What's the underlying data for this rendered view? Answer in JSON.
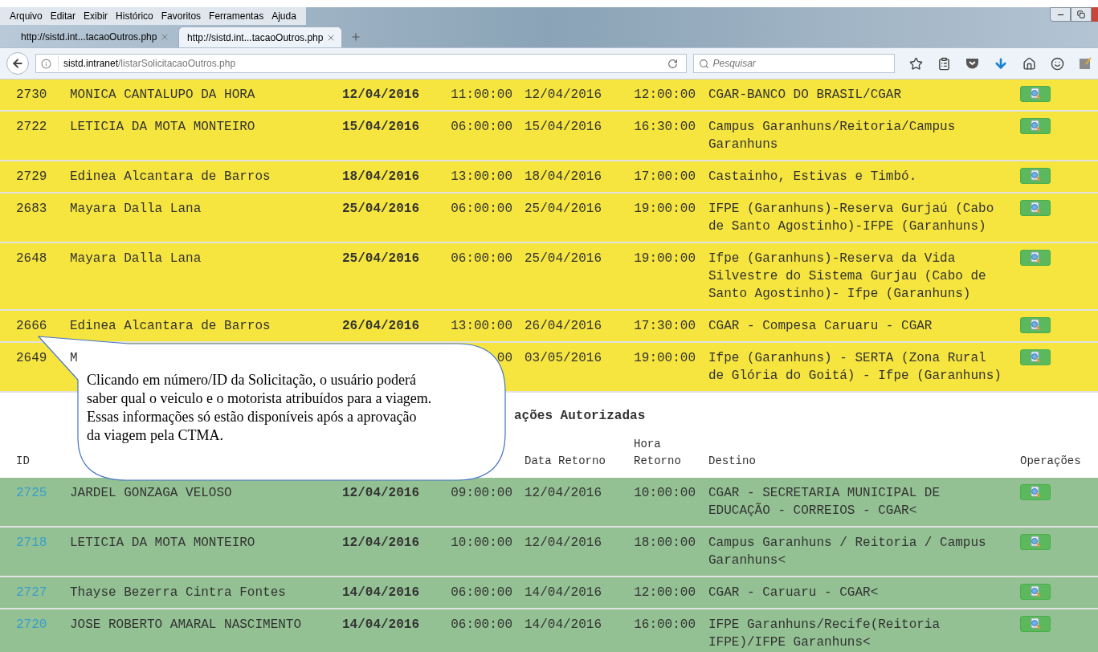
{
  "browser": {
    "menu": [
      "Arquivo",
      "Editar",
      "Exibir",
      "Histórico",
      "Favoritos",
      "Ferramentas",
      "Ajuda"
    ],
    "tabs": [
      {
        "title": "http://sistd.int...tacaoOutros.php",
        "selected": false
      },
      {
        "title": "http://sistd.int...tacaoOutros.php",
        "selected": true
      }
    ],
    "address": {
      "host": "sistd.intranet",
      "path": "/listarSolicitacaoOutros.php"
    },
    "search": {
      "placeholder": "Pesquisar"
    }
  },
  "tables": [
    {
      "kind": "pending",
      "rows": [
        {
          "id": "2730",
          "name": "MONICA CANTALUPO DA HORA",
          "depart_date": "12/04/2016",
          "depart_time": "11:00:00",
          "return_date": "12/04/2016",
          "return_time": "12:00:00",
          "destination": "CGAR-BANCO DO BRASIL/CGAR"
        },
        {
          "id": "2722",
          "name": "LETICIA DA MOTA MONTEIRO",
          "depart_date": "15/04/2016",
          "depart_time": "06:00:00",
          "return_date": "15/04/2016",
          "return_time": "16:30:00",
          "destination": "Campus Garanhuns/Reitoria/Campus Garanhuns"
        },
        {
          "id": "2729",
          "name": "Edinea Alcantara de Barros",
          "depart_date": "18/04/2016",
          "depart_time": "13:00:00",
          "return_date": "18/04/2016",
          "return_time": "17:00:00",
          "destination": "Castainho, Estivas e Timbó."
        },
        {
          "id": "2683",
          "name": "Mayara Dalla Lana",
          "depart_date": "25/04/2016",
          "depart_time": "06:00:00",
          "return_date": "25/04/2016",
          "return_time": "19:00:00",
          "destination": "IFPE (Garanhuns)-Reserva Gurjaú (Cabo de Santo Agostinho)-IFPE (Garanhuns)"
        },
        {
          "id": "2648",
          "name": "Mayara Dalla Lana",
          "depart_date": "25/04/2016",
          "depart_time": "06:00:00",
          "return_date": "25/04/2016",
          "return_time": "19:00:00",
          "destination": "Ifpe (Garanhuns)-Reserva da Vida Silvestre do Sistema Gurjau (Cabo de Santo Agostinho)- Ifpe (Garanhuns)"
        },
        {
          "id": "2666",
          "name": "Edinea Alcantara de Barros",
          "depart_date": "26/04/2016",
          "depart_time": "13:00:00",
          "return_date": "26/04/2016",
          "return_time": "17:30:00",
          "destination": "CGAR - Compesa Caruaru - CGAR"
        },
        {
          "id": "2649",
          "name": "M",
          "depart_time": "00",
          "return_date": "03/05/2016",
          "return_time": "19:00:00",
          "destination": "Ifpe (Garanhuns) - SERTA (Zona Rural de Glória do Goitá) - Ifpe (Garanhuns)"
        }
      ]
    },
    {
      "kind": "authorized",
      "title": "ações Autorizadas",
      "columns": {
        "id": "ID",
        "return_date": "Data Retorno",
        "return_time": "Hora Retorno",
        "destination": "Destino",
        "operations": "Operações"
      },
      "rows": [
        {
          "id": "2725",
          "name": "JARDEL GONZAGA VELOSO",
          "depart_date": "12/04/2016",
          "depart_time": "09:00:00",
          "return_date": "12/04/2016",
          "return_time": "10:00:00",
          "destination": "CGAR - SECRETARIA MUNICIPAL DE EDUCAÇÃO - CORREIOS - CGAR<"
        },
        {
          "id": "2718",
          "name": "LETICIA DA MOTA MONTEIRO",
          "depart_date": "12/04/2016",
          "depart_time": "10:00:00",
          "return_date": "12/04/2016",
          "return_time": "18:00:00",
          "destination": "Campus Garanhuns / Reitoria / Campus Garanhuns<"
        },
        {
          "id": "2727",
          "name": "Thayse Bezerra Cintra Fontes",
          "depart_date": "14/04/2016",
          "depart_time": "06:00:00",
          "return_date": "14/04/2016",
          "return_time": "12:00:00",
          "destination": "CGAR - Caruaru - CGAR<"
        },
        {
          "id": "2720",
          "name": "JOSE ROBERTO AMARAL NASCIMENTO",
          "depart_date": "14/04/2016",
          "depart_time": "06:00:00",
          "return_date": "14/04/2016",
          "return_time": "16:00:00",
          "destination": "IFPE Garanhuns/Recife(Reitoria IFPE)/IFPE Garanhuns<"
        }
      ]
    }
  ],
  "callout": {
    "lines": [
      "Clicando em número/ID da Solicitação, o usuário poderá",
      "saber qual o veiculo e o motorista atribuídos para a viagem.",
      "Essas informações só estão disponíveis após a aprovação",
      "da viagem pela CTMA."
    ]
  }
}
